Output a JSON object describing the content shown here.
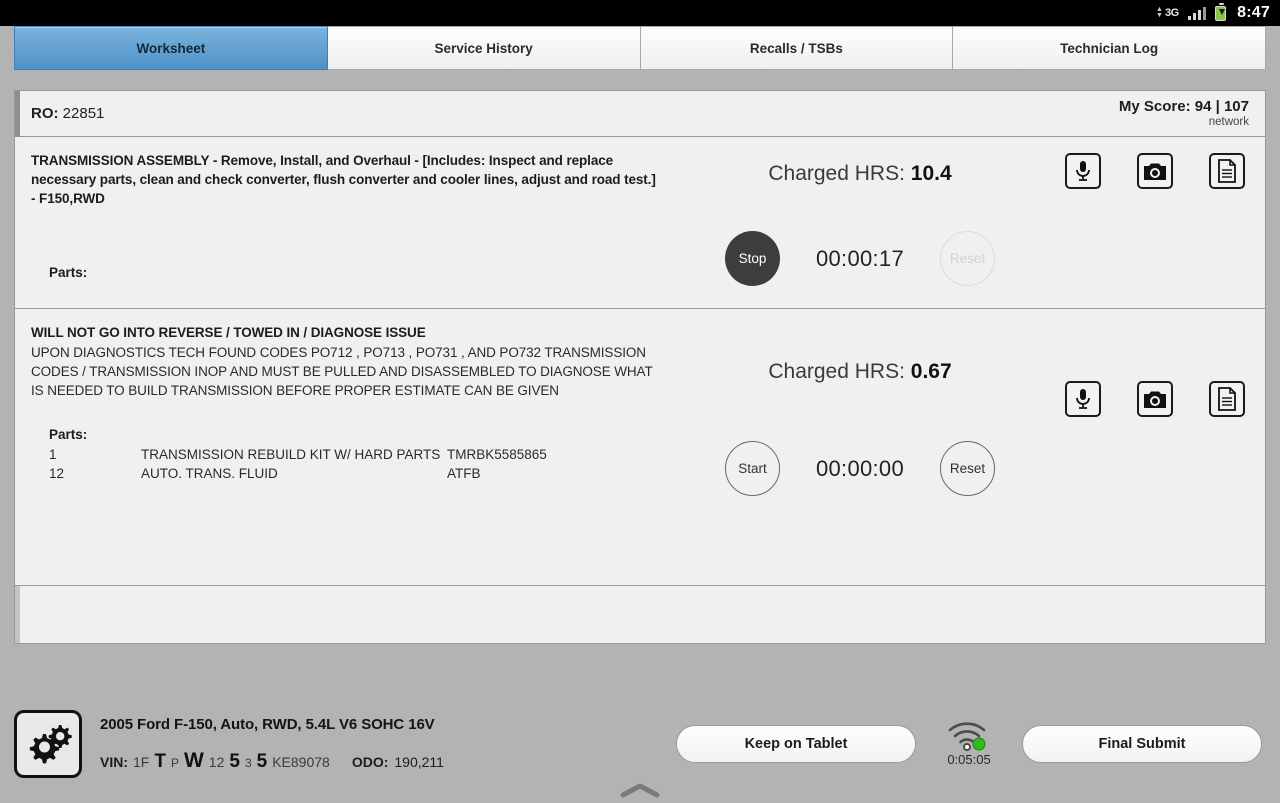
{
  "statusbar": {
    "network_type": "3G",
    "time": "8:47",
    "icons": [
      "data-arrows-icon",
      "signal-bars-icon",
      "battery-icon"
    ]
  },
  "tabs": [
    {
      "label": "Worksheet",
      "active": true
    },
    {
      "label": "Service History",
      "active": false
    },
    {
      "label": "Recalls / TSBs",
      "active": false
    },
    {
      "label": "Technician Log",
      "active": false
    }
  ],
  "header": {
    "ro_label": "RO:",
    "ro_number": "22851",
    "score_text": "My Score: 94 | 107",
    "network_label": "network"
  },
  "jobs": [
    {
      "title": "TRANSMISSION ASSEMBLY - Remove, Install, and Overhaul - [Includes: Inspect and replace necessary parts, clean and check converter, flush converter and cooler lines, adjust and road test.] - F150,RWD",
      "body": "",
      "parts_label": "Parts:",
      "parts": [],
      "charged_label": "Charged HRS:",
      "charged_value": "10.4",
      "timer": "00:00:17",
      "start_stop_label": "Stop",
      "start_stop_state": "running",
      "reset_label": "Reset",
      "reset_enabled": false,
      "actions": [
        "microphone-icon",
        "camera-icon",
        "document-icon"
      ]
    },
    {
      "title": "WILL NOT GO INTO REVERSE / TOWED IN / DIAGNOSE ISSUE",
      "body": "UPON DIAGNOSTICS TECH FOUND CODES PO712 , PO713 , PO731 , AND PO732 TRANSMISSION CODES / TRANSMISSION INOP AND MUST BE PULLED AND DISASSEMBLED TO DIAGNOSE WHAT IS NEEDED TO BUILD TRANSMISSION BEFORE PROPER ESTIMATE CAN BE GIVEN",
      "parts_label": "Parts:",
      "parts": [
        {
          "qty": "1",
          "description": "TRANSMISSION REBUILD KIT W/ HARD PARTS",
          "number": "TMRBK5585865"
        },
        {
          "qty": "12",
          "description": "AUTO. TRANS. FLUID",
          "number": "ATFB"
        }
      ],
      "charged_label": "Charged HRS:",
      "charged_value": "0.67",
      "timer": "00:00:00",
      "start_stop_label": "Start",
      "start_stop_state": "stopped",
      "reset_label": "Reset",
      "reset_enabled": true,
      "actions": [
        "microphone-icon",
        "camera-icon",
        "document-icon"
      ]
    }
  ],
  "footer": {
    "logo_icon": "gears-icon",
    "vehicle": "2005 Ford F-150, Auto, RWD, 5.4L V6 SOHC 16V",
    "vin_label": "VIN:",
    "vin_parts": [
      {
        "text": "1F",
        "emphasis": "normal"
      },
      {
        "text": "T",
        "emphasis": "big"
      },
      {
        "text": "P",
        "emphasis": "small"
      },
      {
        "text": "W",
        "emphasis": "bigger"
      },
      {
        "text": "12",
        "emphasis": "normal"
      },
      {
        "text": "5",
        "emphasis": "big"
      },
      {
        "text": "3",
        "emphasis": "small"
      },
      {
        "text": "5",
        "emphasis": "big"
      },
      {
        "text": "KE89078",
        "emphasis": "normal"
      }
    ],
    "odo_label": "ODO:",
    "odo_value": "190,211",
    "keep_label": "Keep on Tablet",
    "submit_label": "Final Submit",
    "wifi_icon": "wifi-icon",
    "wifi_status_color": "#2fbb1f",
    "sync_time": "0:05:05",
    "nav_handle_icon": "chevron-up-icon"
  }
}
